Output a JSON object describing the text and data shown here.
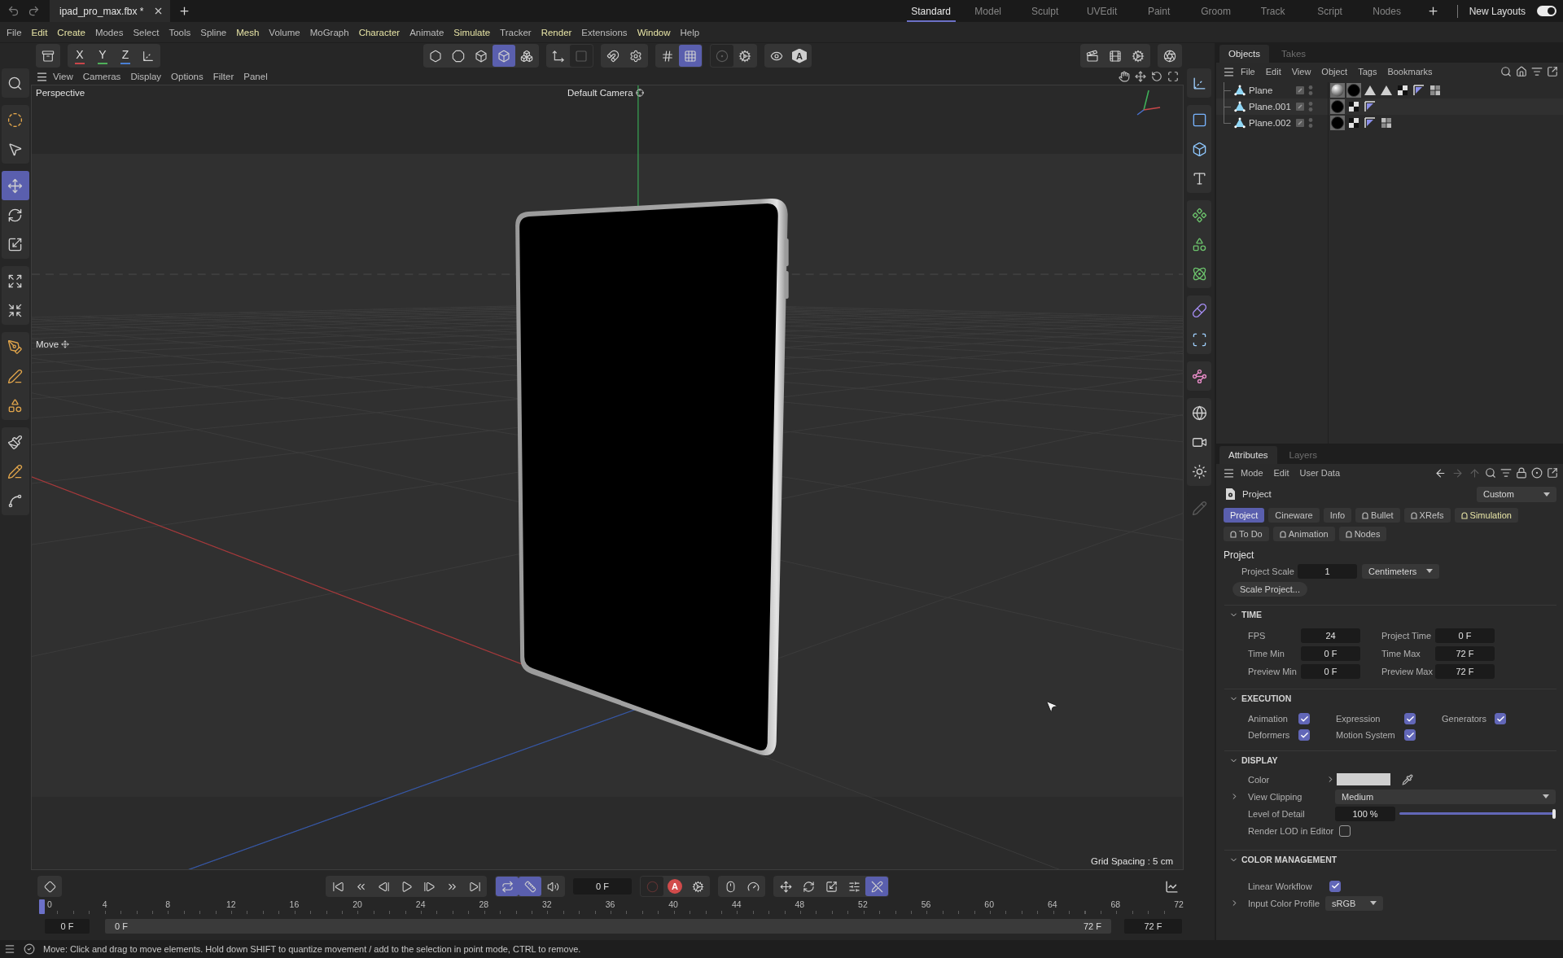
{
  "title_bar": {
    "file_tabs": [
      {
        "label": "ipad_pro_max.fbx *",
        "selected": true
      }
    ],
    "layouts": [
      {
        "label": "Standard",
        "selected": true
      },
      {
        "label": "Model",
        "selected": false
      },
      {
        "label": "Sculpt",
        "selected": false
      },
      {
        "label": "UVEdit",
        "selected": false
      },
      {
        "label": "Paint",
        "selected": false
      },
      {
        "label": "Groom",
        "selected": false
      },
      {
        "label": "Track",
        "selected": false
      },
      {
        "label": "Script",
        "selected": false
      },
      {
        "label": "Nodes",
        "selected": false
      }
    ],
    "new_layouts": {
      "label": "New Layouts",
      "on": true
    }
  },
  "menu_bar": [
    {
      "label": "File",
      "highlighted": false
    },
    {
      "label": "Edit",
      "highlighted": true
    },
    {
      "label": "Create",
      "highlighted": true
    },
    {
      "label": "Modes",
      "highlighted": false
    },
    {
      "label": "Select",
      "highlighted": false
    },
    {
      "label": "Tools",
      "highlighted": false
    },
    {
      "label": "Spline",
      "highlighted": false
    },
    {
      "label": "Mesh",
      "highlighted": true
    },
    {
      "label": "Volume",
      "highlighted": false
    },
    {
      "label": "MoGraph",
      "highlighted": false
    },
    {
      "label": "Character",
      "highlighted": true
    },
    {
      "label": "Animate",
      "highlighted": false
    },
    {
      "label": "Simulate",
      "highlighted": true
    },
    {
      "label": "Tracker",
      "highlighted": false
    },
    {
      "label": "Render",
      "highlighted": true
    },
    {
      "label": "Extensions",
      "highlighted": false
    },
    {
      "label": "Window",
      "highlighted": true
    },
    {
      "label": "Help",
      "highlighted": false
    }
  ],
  "toolbar": {
    "left": [
      [
        {
          "kind": "archive",
          "selected": false,
          "disabled": false
        }
      ],
      [
        {
          "kind": "axis",
          "label": "X",
          "color": "#c9454a",
          "selected": false,
          "disabled": false
        },
        {
          "kind": "axis",
          "label": "Y",
          "color": "#4fb05a",
          "selected": false,
          "disabled": false
        },
        {
          "kind": "axis",
          "label": "Z",
          "color": "#4a7fd4",
          "selected": false,
          "disabled": false
        },
        {
          "kind": "axes-cube",
          "selected": false,
          "disabled": false
        }
      ]
    ],
    "middle": [
      [
        {
          "kind": "points",
          "selected": false,
          "disabled": false
        },
        {
          "kind": "edges",
          "selected": false,
          "disabled": false
        },
        {
          "kind": "polygons",
          "selected": false,
          "disabled": false
        },
        {
          "kind": "model",
          "selected": true,
          "disabled": false
        },
        {
          "kind": "object",
          "selected": false,
          "disabled": false
        }
      ],
      [
        {
          "kind": "axis-corner",
          "selected": false,
          "disabled": false
        },
        {
          "kind": "texture",
          "selected": false,
          "disabled": true
        }
      ],
      [
        {
          "kind": "snap",
          "selected": false,
          "disabled": false
        },
        {
          "kind": "snap-settings",
          "selected": false,
          "disabled": false
        }
      ],
      [
        {
          "kind": "grid",
          "selected": false,
          "disabled": false
        },
        {
          "kind": "grid-snap",
          "selected": true,
          "disabled": false
        }
      ],
      [
        {
          "kind": "solo",
          "selected": false,
          "disabled": true
        },
        {
          "kind": "solo-settings",
          "selected": false,
          "disabled": false
        }
      ],
      [
        {
          "kind": "visibility",
          "selected": false,
          "disabled": false
        },
        {
          "kind": "hex-letter",
          "label": "A",
          "selected": false,
          "disabled": false
        }
      ]
    ],
    "right": [
      [
        {
          "kind": "render-view",
          "selected": false,
          "disabled": false
        },
        {
          "kind": "render",
          "selected": false,
          "disabled": false
        },
        {
          "kind": "render-settings",
          "selected": false,
          "disabled": false
        }
      ],
      [
        {
          "kind": "viewport",
          "selected": false,
          "disabled": false
        }
      ]
    ]
  },
  "left_tools": [
    [
      {
        "kind": "search",
        "selected": false
      }
    ],
    [
      {
        "kind": "live-selection",
        "selected": false
      },
      {
        "kind": "selection-settings",
        "selected": false
      }
    ],
    [
      {
        "kind": "move",
        "selected": true
      },
      {
        "kind": "rotate",
        "selected": false
      },
      {
        "kind": "scale",
        "selected": false
      }
    ],
    [
      {
        "kind": "transform",
        "selected": false
      },
      {
        "kind": "object-transform",
        "selected": false
      }
    ],
    [
      {
        "kind": "spline-arc",
        "selected": false
      },
      {
        "kind": "spline-pen",
        "selected": false
      },
      {
        "kind": "spline-cubes",
        "selected": false
      }
    ],
    [
      {
        "kind": "brush",
        "selected": false
      },
      {
        "kind": "spline-line",
        "selected": false
      },
      {
        "kind": "sketch",
        "selected": false
      }
    ]
  ],
  "right_tools": [
    [
      {
        "kind": "null",
        "selected": false,
        "disabled": false
      }
    ],
    [
      {
        "kind": "plane",
        "selected": false,
        "disabled": false
      },
      {
        "kind": "cube",
        "selected": false,
        "disabled": false
      },
      {
        "kind": "text",
        "selected": false,
        "disabled": false
      }
    ],
    [
      {
        "kind": "subdivision",
        "selected": false,
        "disabled": false
      },
      {
        "kind": "cloner",
        "selected": false,
        "disabled": false
      },
      {
        "kind": "effector",
        "selected": false,
        "disabled": false
      }
    ],
    [
      {
        "kind": "deformer",
        "selected": false,
        "disabled": false
      },
      {
        "kind": "selection",
        "selected": false,
        "disabled": false
      }
    ],
    [
      {
        "kind": "spline",
        "selected": false,
        "disabled": false
      }
    ],
    [
      {
        "kind": "environment",
        "selected": false,
        "disabled": false
      },
      {
        "kind": "camera",
        "selected": false,
        "disabled": false
      },
      {
        "kind": "light",
        "selected": false,
        "disabled": false
      }
    ],
    [
      {
        "kind": "pencil",
        "selected": false,
        "disabled": true
      }
    ]
  ],
  "viewport": {
    "menu": [
      "View",
      "Cameras",
      "Display",
      "Options",
      "Filter",
      "Panel"
    ],
    "view": "Perspective",
    "camera": "Default Camera",
    "tool": "Move",
    "grid_spacing": "Grid Spacing : 5 cm"
  },
  "timeline": {
    "controls": [
      [
        {
          "kind": "keyframe",
          "selected": false,
          "disabled": false
        }
      ],
      [
        {
          "kind": "first",
          "selected": false,
          "disabled": false
        },
        {
          "kind": "prev-key",
          "selected": false,
          "disabled": false
        },
        {
          "kind": "prev",
          "selected": false,
          "disabled": false
        },
        {
          "kind": "play",
          "selected": false,
          "disabled": false
        },
        {
          "kind": "next",
          "selected": false,
          "disabled": false
        },
        {
          "kind": "next-key",
          "selected": false,
          "disabled": false
        },
        {
          "kind": "last",
          "selected": false,
          "disabled": false
        }
      ],
      [
        {
          "kind": "loop",
          "selected": true,
          "disabled": false
        },
        {
          "kind": "range",
          "selected": true,
          "disabled": false
        },
        {
          "kind": "sound",
          "selected": false,
          "disabled": false
        }
      ],
      [
        {
          "kind": "record",
          "selected": false,
          "disabled": true
        },
        {
          "kind": "round-letter",
          "label": "A",
          "selected": false,
          "disabled": false
        },
        {
          "kind": "key-settings",
          "selected": false,
          "disabled": false
        }
      ],
      [
        {
          "kind": "key-mouse",
          "selected": false,
          "disabled": false
        },
        {
          "kind": "gauge",
          "selected": false,
          "disabled": false
        }
      ],
      [
        {
          "kind": "key-move",
          "selected": false,
          "disabled": false
        },
        {
          "kind": "key-rotate",
          "selected": false,
          "disabled": false
        },
        {
          "kind": "key-scale",
          "selected": false,
          "disabled": false
        },
        {
          "kind": "key-param",
          "selected": false,
          "disabled": false
        },
        {
          "kind": "key-pla",
          "selected": true,
          "disabled": false
        }
      ]
    ],
    "current_frame": "0 F",
    "ruler": [
      "0",
      "4",
      "8",
      "12",
      "16",
      "20",
      "24",
      "28",
      "32",
      "36",
      "40",
      "44",
      "48",
      "52",
      "56",
      "60",
      "64",
      "68",
      "72"
    ],
    "playhead": {
      "level": 0
    },
    "start": "0 F",
    "range": {
      "start": "0 F",
      "end": "72 F"
    },
    "end": "72 F"
  },
  "objects_panel": {
    "tabs": [
      {
        "label": "Objects",
        "selected": true
      },
      {
        "label": "Takes",
        "selected": false
      }
    ],
    "menu": [
      "File",
      "Edit",
      "View",
      "Object",
      "Tags",
      "Bookmarks"
    ],
    "objects": [
      {
        "name": "Plane",
        "tags": [
          {
            "kind": "material-gradient"
          },
          {
            "kind": "material-dark"
          },
          {
            "kind": "triangle"
          },
          {
            "kind": "triangle"
          },
          {
            "kind": "checker"
          },
          {
            "kind": "phong"
          },
          {
            "kind": "quad"
          }
        ]
      },
      {
        "name": "Plane.001",
        "tags": [
          {
            "kind": "material-dark"
          },
          {
            "kind": "checker"
          },
          {
            "kind": "phong"
          }
        ]
      },
      {
        "name": "Plane.002",
        "tags": [
          {
            "kind": "material-dark"
          },
          {
            "kind": "checker"
          },
          {
            "kind": "phong"
          },
          {
            "kind": "quad"
          }
        ]
      }
    ]
  },
  "attributes_panel": {
    "tabs": [
      {
        "label": "Attributes",
        "selected": true
      },
      {
        "label": "Layers",
        "selected": false
      }
    ],
    "menu": [
      "Mode",
      "Edit",
      "User Data"
    ],
    "nav": [
      {
        "kind": "back",
        "disabled": false
      },
      {
        "kind": "forward",
        "disabled": true
      },
      {
        "kind": "up",
        "disabled": true
      }
    ],
    "header": {
      "title": "Project",
      "mode": "Custom"
    },
    "page_tabs": [
      {
        "label": "Project",
        "selected": true,
        "highlighted": false,
        "has_icon": false
      },
      {
        "label": "Cineware",
        "selected": false,
        "highlighted": false,
        "has_icon": false
      },
      {
        "label": "Info",
        "selected": false,
        "highlighted": false,
        "has_icon": false
      },
      {
        "label": "Bullet",
        "selected": false,
        "highlighted": false,
        "has_icon": true
      },
      {
        "label": "XRefs",
        "selected": false,
        "highlighted": false,
        "has_icon": true
      },
      {
        "label": "Simulation",
        "selected": false,
        "highlighted": true,
        "has_icon": true
      },
      {
        "label": "To Do",
        "selected": false,
        "highlighted": false,
        "has_icon": true
      },
      {
        "label": "Animation",
        "selected": false,
        "highlighted": false,
        "has_icon": true
      },
      {
        "label": "Nodes",
        "selected": false,
        "highlighted": false,
        "has_icon": true
      }
    ],
    "project": {
      "title": "Project",
      "scale": {
        "label": "Project Scale",
        "value": "1",
        "unit": "Centimeters"
      },
      "button": "Scale Project..."
    },
    "time": {
      "title": "TIME",
      "expanded": true,
      "fields": [
        {
          "label": "FPS",
          "value": "24"
        },
        {
          "label": "Project Time",
          "value": "0 F"
        },
        {
          "label": "Time Min",
          "value": "0 F"
        },
        {
          "label": "Time Max",
          "value": "72 F"
        },
        {
          "label": "Preview Min",
          "value": "0 F"
        },
        {
          "label": "Preview Max",
          "value": "72 F"
        }
      ]
    },
    "execution": {
      "title": "EXECUTION",
      "expanded": true,
      "options": [
        {
          "label": "Animation",
          "checked": true
        },
        {
          "label": "Expression",
          "checked": true
        },
        {
          "label": "Generators",
          "checked": true
        },
        {
          "label": "Deformers",
          "checked": true
        },
        {
          "label": "Motion System",
          "checked": true
        }
      ]
    },
    "display": {
      "title": "DISPLAY",
      "expanded": true,
      "color": {
        "label": "Color",
        "color": "#d0d0d0",
        "expanded": false
      },
      "view_clipping": {
        "label": "View Clipping",
        "value": "Medium",
        "expanded": false
      },
      "level_of_detail": {
        "label": "Level of Detail",
        "value": "100 %",
        "level": 1
      },
      "render_lod": {
        "label": "Render LOD in Editor",
        "checked": false
      }
    },
    "color_management": {
      "title": "COLOR MANAGEMENT",
      "expanded": true,
      "linear_workflow": {
        "label": "Linear Workflow",
        "checked": true
      },
      "input_color_profile": {
        "label": "Input Color Profile",
        "value": "sRGB",
        "expanded": false
      }
    }
  },
  "status_bar": {
    "message": "Move: Click and drag to move elements. Hold down SHIFT to quantize movement / add to the selection in point mode, CTRL to remove."
  }
}
